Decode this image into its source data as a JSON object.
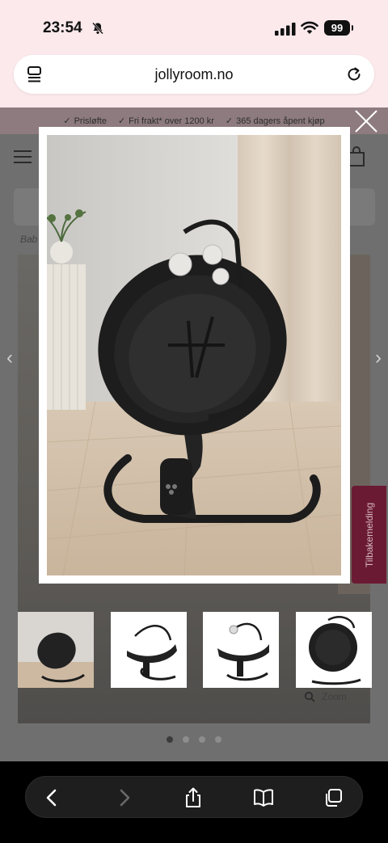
{
  "status_bar": {
    "time": "23:54",
    "battery": "99",
    "icons": [
      "bell-slash-icon",
      "cellular-signal-icon",
      "wifi-icon",
      "battery-icon"
    ]
  },
  "browser": {
    "url": "jollyroom.no",
    "icons": [
      "page-menu-icon",
      "reload-icon"
    ]
  },
  "page": {
    "usp": [
      "Prisløfte",
      "Fri frakt* over 1200 kr",
      "365 dagers åpent kjøp"
    ],
    "breadcrumb": "Bab",
    "feedback_label": "Tilbakemelding",
    "zoom_label": "Zoom",
    "dots_count": 4,
    "active_dot": 0
  },
  "lightbox": {
    "image": "baby-bouncer-main-image",
    "thumbnails": [
      {
        "name": "thumb-bouncer-room",
        "selected": true
      },
      {
        "name": "thumb-bouncer-side",
        "selected": false
      },
      {
        "name": "thumb-bouncer-angle",
        "selected": false
      },
      {
        "name": "thumb-bouncer-front",
        "selected": false
      }
    ]
  },
  "toolbar": {
    "icons": [
      "back-icon",
      "forward-icon",
      "share-icon",
      "bookmarks-icon",
      "tabs-icon"
    ]
  },
  "colors": {
    "status_bg": "#fbe9ec",
    "usp_bg": "#8d7b7f",
    "overlay": "#6f6f6f",
    "feedback_tab": "#6b1a34",
    "toolbar_bg": "#000000"
  }
}
